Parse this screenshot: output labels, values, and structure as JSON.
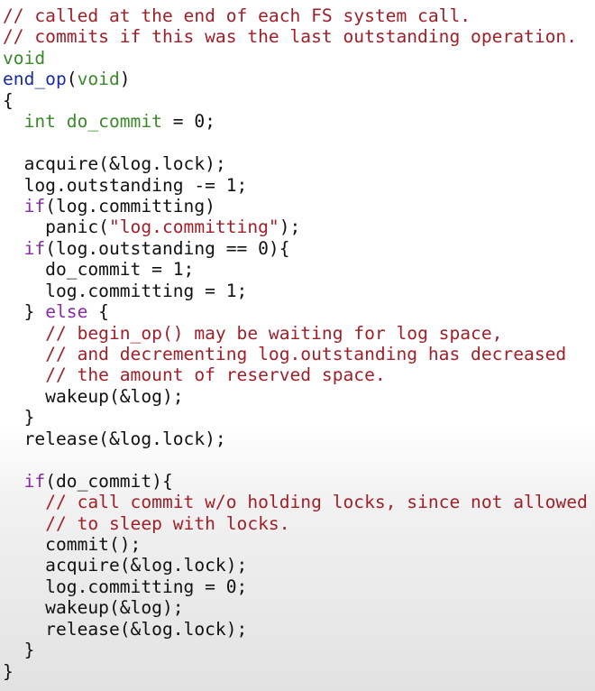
{
  "colors": {
    "comment": "#a0202a",
    "type": "#3a8a2a",
    "function": "#1a2aa0",
    "keyword": "#8a2aa8",
    "string": "#a0202a",
    "text": "#111111"
  },
  "code": {
    "lines": [
      [
        {
          "t": "// called at the end of each FS system call.",
          "k": "comment"
        }
      ],
      [
        {
          "t": "// commits if this was the last outstanding operation.",
          "k": "comment"
        }
      ],
      [
        {
          "t": "void",
          "k": "type"
        }
      ],
      [
        {
          "t": "end_op",
          "k": "func"
        },
        {
          "t": "(",
          "k": "plain"
        },
        {
          "t": "void",
          "k": "type"
        },
        {
          "t": ")",
          "k": "plain"
        }
      ],
      [
        {
          "t": "{",
          "k": "plain"
        }
      ],
      [
        {
          "t": "  ",
          "k": "plain"
        },
        {
          "t": "int",
          "k": "type"
        },
        {
          "t": " ",
          "k": "plain"
        },
        {
          "t": "do_commit",
          "k": "type"
        },
        {
          "t": " = 0;",
          "k": "plain"
        }
      ],
      [
        {
          "t": "",
          "k": "plain"
        }
      ],
      [
        {
          "t": "  acquire(&log.lock);",
          "k": "plain"
        }
      ],
      [
        {
          "t": "  log.outstanding -= 1;",
          "k": "plain"
        }
      ],
      [
        {
          "t": "  ",
          "k": "plain"
        },
        {
          "t": "if",
          "k": "kw"
        },
        {
          "t": "(log.committing)",
          "k": "plain"
        }
      ],
      [
        {
          "t": "    panic(",
          "k": "plain"
        },
        {
          "t": "\"log.committing\"",
          "k": "str"
        },
        {
          "t": ");",
          "k": "plain"
        }
      ],
      [
        {
          "t": "  ",
          "k": "plain"
        },
        {
          "t": "if",
          "k": "kw"
        },
        {
          "t": "(log.outstanding == 0){",
          "k": "plain"
        }
      ],
      [
        {
          "t": "    do_commit = 1;",
          "k": "plain"
        }
      ],
      [
        {
          "t": "    log.committing = 1;",
          "k": "plain"
        }
      ],
      [
        {
          "t": "  } ",
          "k": "plain"
        },
        {
          "t": "else",
          "k": "kw"
        },
        {
          "t": " {",
          "k": "plain"
        }
      ],
      [
        {
          "t": "    ",
          "k": "plain"
        },
        {
          "t": "// begin_op() may be waiting for log space,",
          "k": "comment"
        }
      ],
      [
        {
          "t": "    ",
          "k": "plain"
        },
        {
          "t": "// and decrementing log.outstanding has decreased",
          "k": "comment"
        }
      ],
      [
        {
          "t": "    ",
          "k": "plain"
        },
        {
          "t": "// the amount of reserved space.",
          "k": "comment"
        }
      ],
      [
        {
          "t": "    wakeup(&log);",
          "k": "plain"
        }
      ],
      [
        {
          "t": "  }",
          "k": "plain"
        }
      ],
      [
        {
          "t": "  release(&log.lock);",
          "k": "plain"
        }
      ],
      [
        {
          "t": "",
          "k": "plain"
        }
      ],
      [
        {
          "t": "  ",
          "k": "plain"
        },
        {
          "t": "if",
          "k": "kw"
        },
        {
          "t": "(do_commit){",
          "k": "plain"
        }
      ],
      [
        {
          "t": "    ",
          "k": "plain"
        },
        {
          "t": "// call commit w/o holding locks, since not allowed",
          "k": "comment"
        }
      ],
      [
        {
          "t": "    ",
          "k": "plain"
        },
        {
          "t": "// to sleep with locks.",
          "k": "comment"
        }
      ],
      [
        {
          "t": "    commit();",
          "k": "plain"
        }
      ],
      [
        {
          "t": "    acquire(&log.lock);",
          "k": "plain"
        }
      ],
      [
        {
          "t": "    log.committing = 0;",
          "k": "plain"
        }
      ],
      [
        {
          "t": "    wakeup(&log);",
          "k": "plain"
        }
      ],
      [
        {
          "t": "    release(&log.lock);",
          "k": "plain"
        }
      ],
      [
        {
          "t": "  }",
          "k": "plain"
        }
      ],
      [
        {
          "t": "}",
          "k": "plain"
        }
      ]
    ]
  }
}
